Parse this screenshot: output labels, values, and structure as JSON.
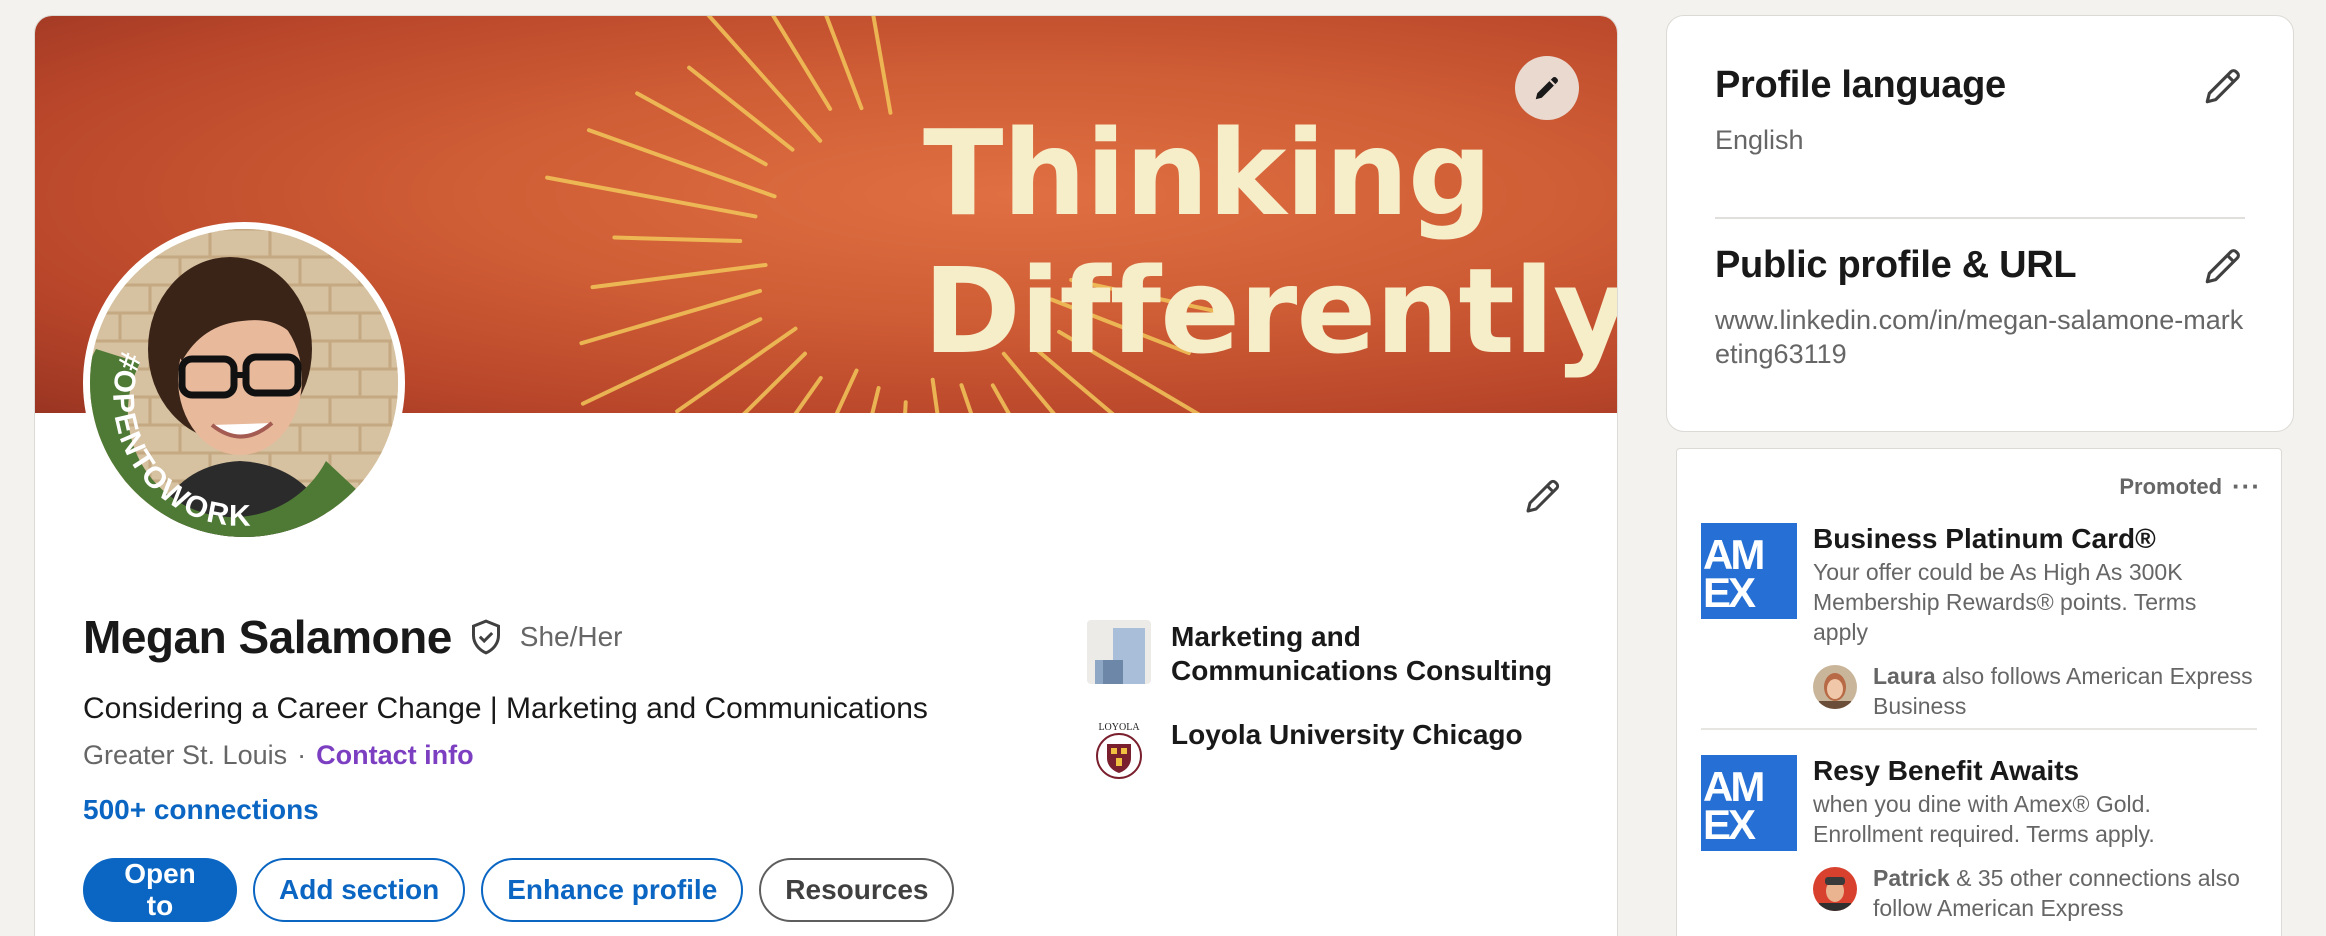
{
  "colors": {
    "accent": "#0a66c2",
    "contact_link": "#7c3fc1",
    "open_to_work_green": "#4e7a35",
    "amex_blue": "#2670d5",
    "banner": "#cf5d35",
    "page_bg": "#f4f2ee"
  },
  "banner": {
    "line1": "Thinking",
    "line2": "Differently",
    "edit_icon": "pencil-icon"
  },
  "profile": {
    "frame_text": "#OPENTOWORK",
    "name": "Megan Salamone",
    "verified_icon": "shield-check-icon",
    "pronouns": "She/Her",
    "headline": "Considering a Career Change | Marketing and Communications",
    "location": "Greater St. Louis",
    "separator": "·",
    "contact_label": "Contact info",
    "connections": "500+ connections",
    "edit_icon": "pencil-icon"
  },
  "actions": {
    "open_to": "Open to",
    "add_section": "Add section",
    "enhance_profile": "Enhance profile",
    "resources": "Resources"
  },
  "organizations": [
    {
      "name": "Marketing and Communications Consulting",
      "logo": "company-logo-icon"
    },
    {
      "name": "Loyola University Chicago",
      "logo": "loyola-seal-icon",
      "logo_text": "LOYOLA"
    }
  ],
  "sidebar": {
    "profile_language": {
      "title": "Profile language",
      "value": "English"
    },
    "public_profile": {
      "title": "Public profile & URL",
      "value": "www.linkedin.com/in/megan-salamone-marketing63119"
    }
  },
  "ads": {
    "promoted_label": "Promoted",
    "more_label": "···",
    "logo_text": "AMEX",
    "items": [
      {
        "title": "Business Platinum Card®",
        "description": "Your offer could be As High As 300K Membership Rewards® points. Terms apply",
        "social_name": "Laura",
        "social_rest": " also follows American Express Business"
      },
      {
        "title": "Resy Benefit Awaits",
        "description": "when you dine with Amex® Gold. Enrollment required. Terms apply.",
        "social_name": "Patrick",
        "social_rest": " & 35 other connections also follow American Express"
      }
    ]
  }
}
